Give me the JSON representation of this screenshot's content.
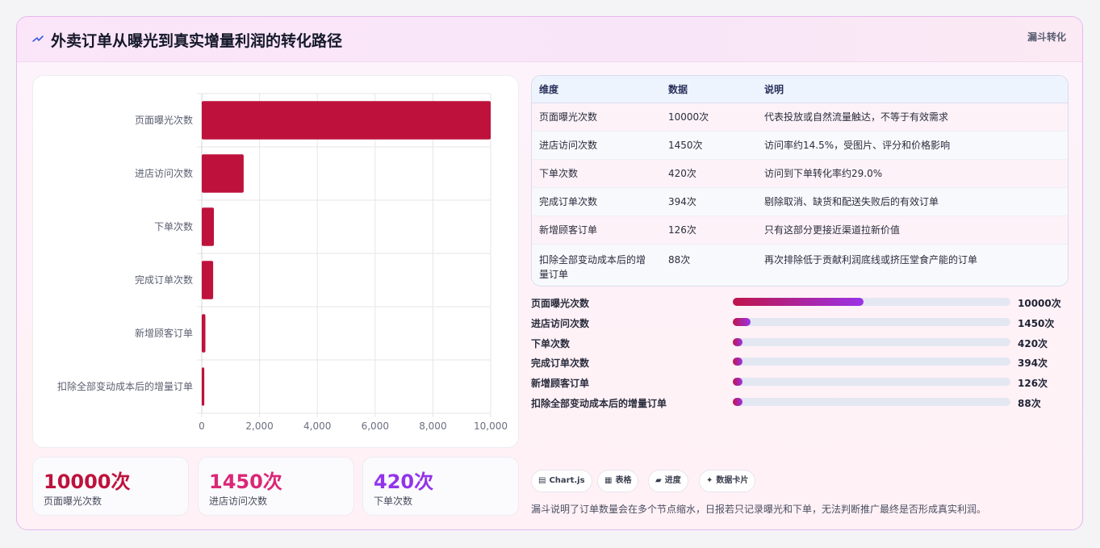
{
  "header": {
    "icon": "spark-icon",
    "title": "外卖订单从曝光到真实增量利润的转化路径",
    "badge": "漏斗转化"
  },
  "chart_data": {
    "type": "bar",
    "orientation": "horizontal",
    "categories": [
      "页面曝光次数",
      "进店访问次数",
      "下单次数",
      "完成订单次数",
      "新增顾客订单",
      "扣除全部变动成本后的增量订单"
    ],
    "values": [
      10000,
      1450,
      420,
      394,
      126,
      88
    ],
    "xlim": [
      0,
      10000
    ],
    "xticks": [
      "0",
      "2,000",
      "4,000",
      "6,000",
      "8,000",
      "10,000"
    ],
    "xtick_values": [
      0,
      2000,
      4000,
      6000,
      8000,
      10000
    ],
    "grid": true,
    "bar_color": "#be123c"
  },
  "kpis": [
    {
      "value": "10000次",
      "label": "页面曝光次数",
      "color": "#be123c"
    },
    {
      "value": "1450次",
      "label": "进店访问次数",
      "color": "#db2777"
    },
    {
      "value": "420次",
      "label": "下单次数",
      "color": "#9333ea"
    }
  ],
  "table": {
    "headers": [
      "维度",
      "数据",
      "说明"
    ],
    "rows": [
      {
        "dim": "页面曝光次数",
        "data": "10000次",
        "desc": "代表投放或自然流量触达，不等于有效需求"
      },
      {
        "dim": "进店访问次数",
        "data": "1450次",
        "desc": "访问率约14.5%，受图片、评分和价格影响"
      },
      {
        "dim": "下单次数",
        "data": "420次",
        "desc": "访问到下单转化率约29.0%"
      },
      {
        "dim": "完成订单次数",
        "data": "394次",
        "desc": "剔除取消、缺货和配送失败后的有效订单"
      },
      {
        "dim": "新增顾客订单",
        "data": "126次",
        "desc": "只有这部分更接近渠道拉新价值"
      },
      {
        "dim": "扣除全部变动成本后的增量订单",
        "data": "88次",
        "desc": "再次排除低于贡献利润底线或挤压堂食产能的订单"
      }
    ]
  },
  "progress": [
    {
      "label": "页面曝光次数",
      "value": "10000次",
      "fraction": 0.47
    },
    {
      "label": "进店访问次数",
      "value": "1450次",
      "fraction": 0.065
    },
    {
      "label": "下单次数",
      "value": "420次",
      "fraction": 0.035
    },
    {
      "label": "完成订单次数",
      "value": "394次",
      "fraction": 0.035
    },
    {
      "label": "新增顾客订单",
      "value": "126次",
      "fraction": 0.035
    },
    {
      "label": "扣除全部变动成本后的增量订单",
      "value": "88次",
      "fraction": 0.035
    }
  ],
  "tags": [
    {
      "icon": "chart-icon",
      "glyph": "▤",
      "label": "Chart.js"
    },
    {
      "icon": "table-icon",
      "glyph": "▦",
      "label": "表格"
    },
    {
      "icon": "progress-icon",
      "glyph": "▰",
      "label": "进度"
    },
    {
      "icon": "card-icon",
      "glyph": "✦",
      "label": "数据卡片"
    }
  ],
  "note": "漏斗说明了订单数量会在多个节点缩水，日报若只记录曝光和下单，无法判断推广最终是否形成真实利润。"
}
